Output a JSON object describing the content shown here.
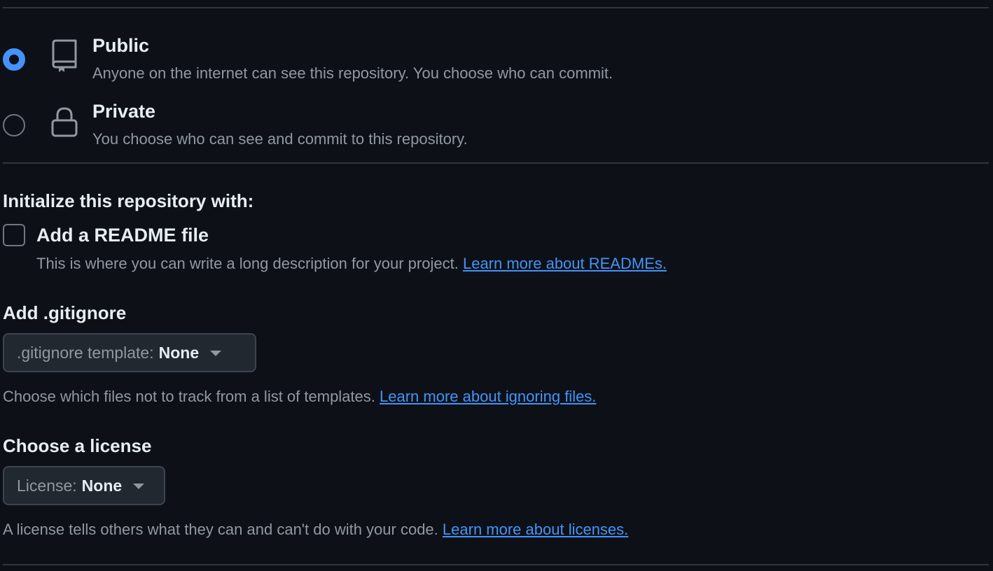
{
  "visibility": {
    "options": [
      {
        "title": "Public",
        "description": "Anyone on the internet can see this repository. You choose who can commit.",
        "selected": true,
        "icon": "repo-icon"
      },
      {
        "title": "Private",
        "description": "You choose who can see and commit to this repository.",
        "selected": false,
        "icon": "lock-icon"
      }
    ]
  },
  "initialize": {
    "heading": "Initialize this repository with:",
    "readme": {
      "label": "Add a README file",
      "checked": false,
      "help": "This is where you can write a long description for your project.",
      "link": "Learn more about READMEs."
    }
  },
  "gitignore": {
    "heading": "Add .gitignore",
    "dropdown_label": ".gitignore template:",
    "dropdown_value": "None",
    "help": "Choose which files not to track from a list of templates.",
    "link": "Learn more about ignoring files."
  },
  "license": {
    "heading": "Choose a license",
    "dropdown_label": "License:",
    "dropdown_value": "None",
    "help": "A license tells others what they can and can't do with your code.",
    "link": "Learn more about licenses."
  },
  "colors": {
    "background": "#0d1117",
    "accent": "#4493f8",
    "text": "#e6edf3",
    "muted": "#9198a1",
    "border": "#30363d"
  }
}
